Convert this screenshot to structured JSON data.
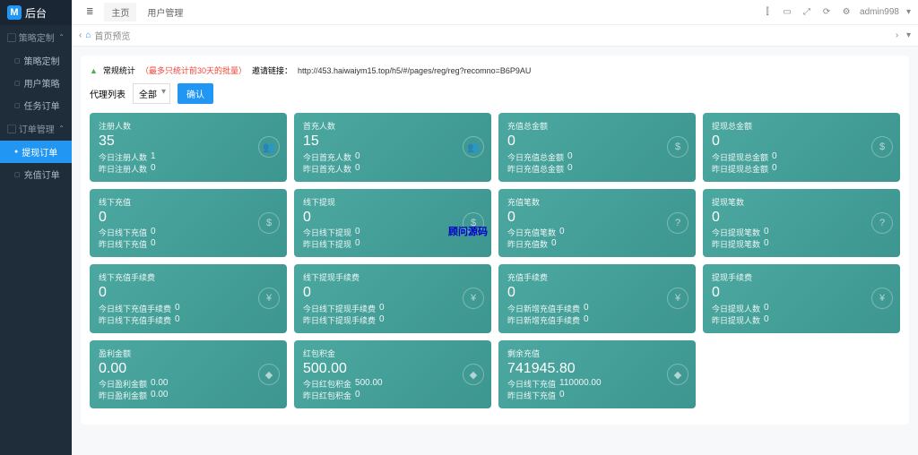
{
  "brand": "后台",
  "sidebar": {
    "groups": [
      {
        "label": "策略定制",
        "items": [
          {
            "label": "策略定制"
          },
          {
            "label": "用户策略"
          },
          {
            "label": "任务订单"
          }
        ]
      },
      {
        "label": "订单管理",
        "items": [
          {
            "label": "提现订单",
            "active": true
          },
          {
            "label": "充值订单"
          }
        ]
      }
    ]
  },
  "topbar": {
    "tabs": [
      {
        "label": "≣"
      },
      {
        "label": "主页",
        "active": true
      },
      {
        "label": "用户管理"
      }
    ],
    "user": "admin998"
  },
  "breadcrumb": {
    "home": "首页预览"
  },
  "info": {
    "prefix": "常规统计",
    "redText": "（最多只统计前30天的批量）",
    "linkLabel": "邀请链接：",
    "url": "http://453.haiwaiym15.top/h5/#/pages/reg/reg?recomno=B6P9AU"
  },
  "filter": {
    "label": "代理列表",
    "value": "全部",
    "button": "确认"
  },
  "cards": [
    [
      {
        "t": "注册人数",
        "v": "35",
        "l1": "今日注册人数",
        "n1": "1",
        "l2": "昨日注册人数",
        "n2": "0",
        "icon": "👥"
      },
      {
        "t": "首充人数",
        "v": "15",
        "l1": "今日首充人数",
        "n1": "0",
        "l2": "昨日首充人数",
        "n2": "0",
        "icon": "👥"
      },
      {
        "t": "充值总金额",
        "v": "0",
        "l1": "今日充值总金额",
        "n1": "0",
        "l2": "昨日充值总金额",
        "n2": "0",
        "icon": "$"
      },
      {
        "t": "提现总金额",
        "v": "0",
        "l1": "今日提现总金额",
        "n1": "0",
        "l2": "昨日提现总金额",
        "n2": "0",
        "icon": "$"
      }
    ],
    [
      {
        "t": "线下充值",
        "v": "0",
        "l1": "今日线下充值",
        "n1": "0",
        "l2": "昨日线下充值",
        "n2": "0",
        "icon": "$"
      },
      {
        "t": "线下提现",
        "v": "0",
        "l1": "今日线下提现",
        "n1": "0",
        "l2": "昨日线下提现",
        "n2": "0",
        "icon": "$"
      },
      {
        "t": "充值笔数",
        "v": "0",
        "l1": "今日充值笔数",
        "n1": "0",
        "l2": "昨日充值数",
        "n2": "0",
        "icon": "?"
      },
      {
        "t": "提现笔数",
        "v": "0",
        "l1": "今日提现笔数",
        "n1": "0",
        "l2": "昨日提现笔数",
        "n2": "0",
        "icon": "?"
      }
    ],
    [
      {
        "t": "线下充值手续费",
        "v": "0",
        "l1": "今日线下充值手续费",
        "n1": "0",
        "l2": "昨日线下充值手续费",
        "n2": "0",
        "icon": "¥"
      },
      {
        "t": "线下提现手续费",
        "v": "0",
        "l1": "今日线下提现手续费",
        "n1": "0",
        "l2": "昨日线下提现手续费",
        "n2": "0",
        "icon": "¥"
      },
      {
        "t": "充值手续费",
        "v": "0",
        "l1": "今日新增充值手续费",
        "n1": "0",
        "l2": "昨日新增充值手续费",
        "n2": "0",
        "icon": "¥"
      },
      {
        "t": "提现手续费",
        "v": "0",
        "l1": "今日提现人数",
        "n1": "0",
        "l2": "昨日提现人数",
        "n2": "0",
        "icon": "¥"
      }
    ],
    [
      {
        "t": "盈利金额",
        "v": "0.00",
        "l1": "今日盈利金额",
        "n1": "0.00",
        "l2": "昨日盈利金额",
        "n2": "0.00",
        "icon": "◆"
      },
      {
        "t": "红包积金",
        "v": "500.00",
        "l1": "今日红包积金",
        "n1": "500.00",
        "l2": "昨日红包积金",
        "n2": "0",
        "icon": "◆"
      },
      {
        "t": "剩余充值",
        "v": "741945.80",
        "l1": "今日线下充值",
        "n1": "110000.00",
        "l2": "昨日线下充值",
        "n2": "0",
        "icon": "◆"
      }
    ]
  ],
  "watermark": "顾问源码"
}
